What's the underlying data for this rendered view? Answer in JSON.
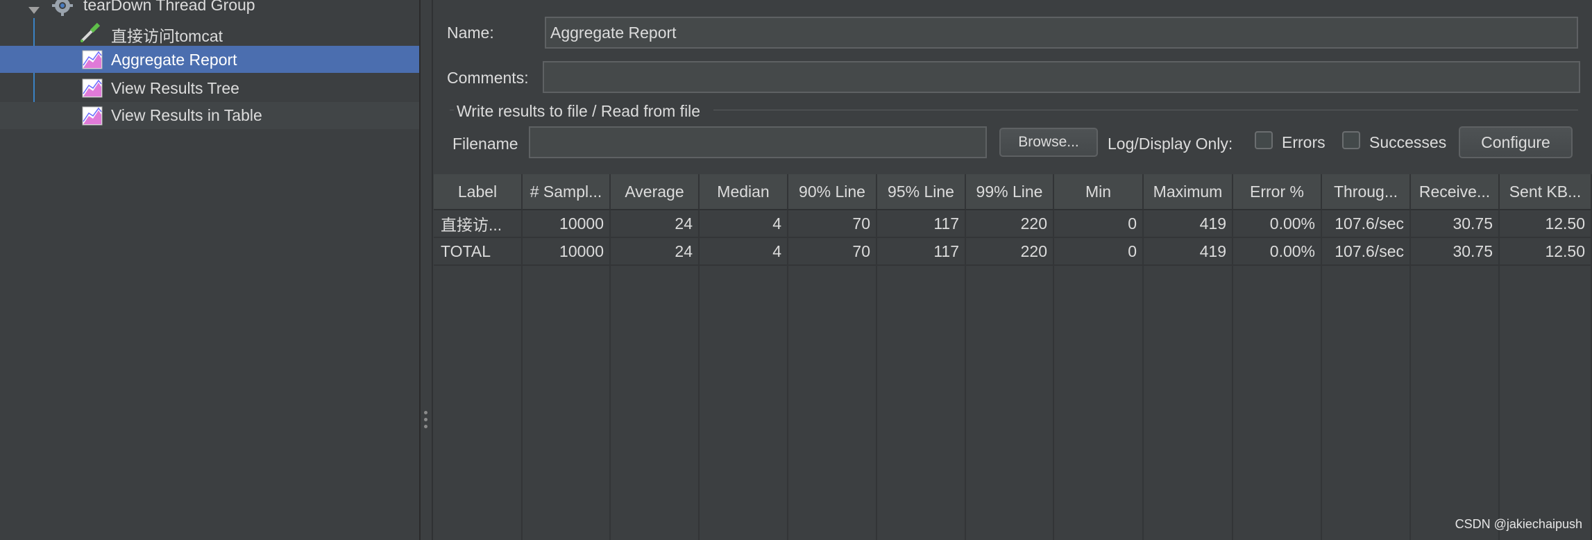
{
  "tree": {
    "items": [
      {
        "label": "tearDown Thread Group",
        "icon": "gear-icon"
      },
      {
        "label": "直接访问tomcat",
        "icon": "pipette-sampler-icon"
      },
      {
        "label": "Aggregate Report",
        "icon": "listener-graph-icon",
        "selected": true
      },
      {
        "label": "View Results Tree",
        "icon": "listener-graph-icon"
      },
      {
        "label": "View Results in Table",
        "icon": "listener-graph-icon"
      }
    ]
  },
  "form": {
    "name_label": "Name:",
    "name_value": "Aggregate Report",
    "comments_label": "Comments:",
    "comments_value": "",
    "file_section_title": "Write results to file / Read from file",
    "filename_label": "Filename",
    "filename_value": "",
    "browse_label": "Browse...",
    "log_display_label": "Log/Display Only:",
    "errors_label": "Errors",
    "errors_checked": false,
    "successes_label": "Successes",
    "successes_checked": false,
    "configure_label": "Configure"
  },
  "table": {
    "columns": [
      "Label",
      "# Sampl...",
      "Average",
      "Median",
      "90% Line",
      "95% Line",
      "99% Line",
      "Min",
      "Maximum",
      "Error %",
      "Throug...",
      "Receive...",
      "Sent KB..."
    ],
    "rows": [
      [
        "直接访...",
        "10000",
        "24",
        "4",
        "70",
        "117",
        "220",
        "0",
        "419",
        "0.00%",
        "107.6/sec",
        "30.75",
        "12.50"
      ],
      [
        "TOTAL",
        "10000",
        "24",
        "4",
        "70",
        "117",
        "220",
        "0",
        "419",
        "0.00%",
        "107.6/sec",
        "30.75",
        "12.50"
      ]
    ]
  },
  "watermark": "CSDN @jakiechaipush",
  "colors": {
    "background": "#3c3f41",
    "selection": "#4b6eaf",
    "text": "#dcdcdc"
  }
}
